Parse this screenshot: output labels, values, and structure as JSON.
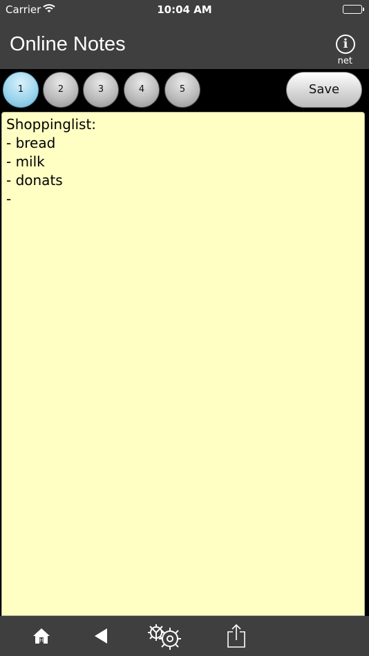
{
  "status_bar": {
    "carrier": "Carrier",
    "time": "10:04 AM"
  },
  "nav": {
    "title": "Online Notes",
    "info_label": "i",
    "info_caption": "net"
  },
  "tabs": [
    {
      "label": "1",
      "active": true
    },
    {
      "label": "2",
      "active": false
    },
    {
      "label": "3",
      "active": false
    },
    {
      "label": "4",
      "active": false
    },
    {
      "label": "5",
      "active": false
    }
  ],
  "save_label": "Save",
  "note": {
    "text": "Shoppinglist:\n- bread\n- milk\n- donats\n-"
  },
  "colors": {
    "bar_background": "#3f3f3f",
    "note_background": "#ffffc4",
    "active_tab": "#9fd6ee"
  },
  "toolbar_icons": [
    "home-icon",
    "back-icon",
    "settings-gears-icon",
    "share-icon"
  ]
}
